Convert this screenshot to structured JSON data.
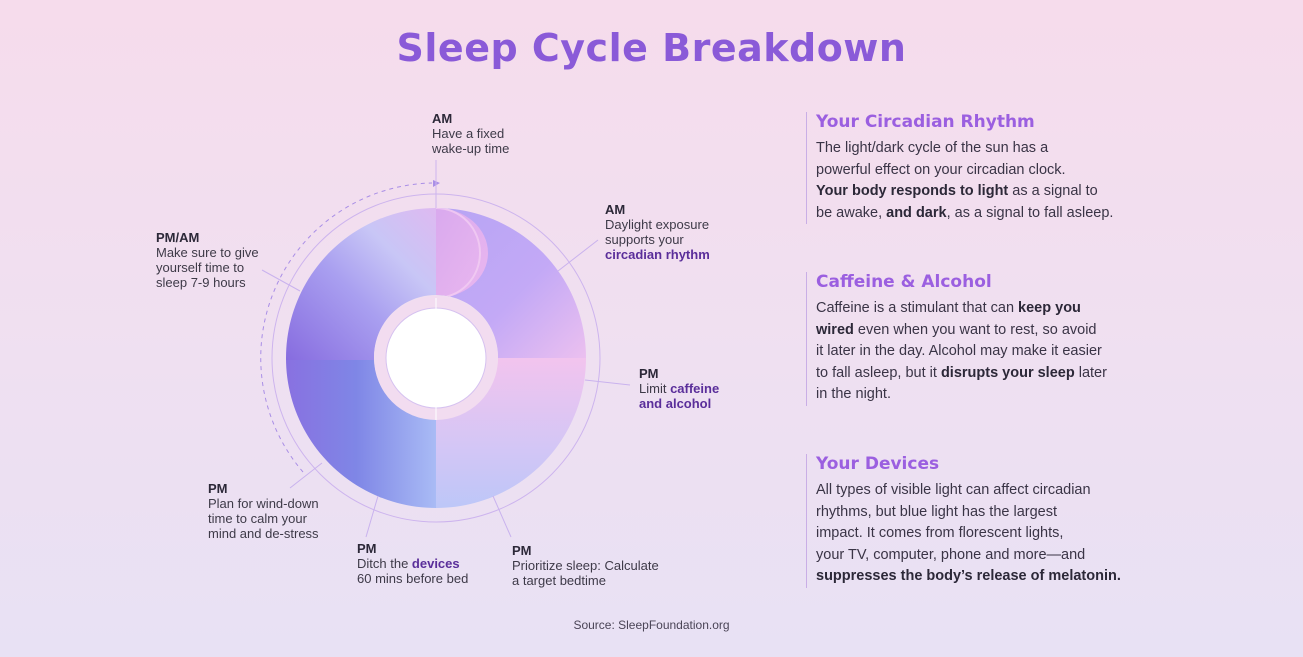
{
  "title": "Sleep Cycle Breakdown",
  "source": "Source: SleepFoundation.org",
  "colors": {
    "title": "#8a5ad8",
    "heading": "#9b5fe0",
    "highlight": "#5a2e9a",
    "ring_outline": "#cdb4ee"
  },
  "diagram": {
    "labels": {
      "am_wake": {
        "head": "AM",
        "l1": "Have a fixed",
        "l2": "wake-up time"
      },
      "am_daylight": {
        "head": "AM",
        "l1": "Daylight exposure",
        "l2": "supports your",
        "l3": "circadian rhythm"
      },
      "pm_caffeine": {
        "head": "PM",
        "l1a": "Limit ",
        "l1b": "caffeine",
        "l2": "and alcohol"
      },
      "pm_prioritize": {
        "head": "PM",
        "l1": "Prioritize sleep: Calculate",
        "l2": "a target bedtime"
      },
      "pm_devices": {
        "head": "PM",
        "l1a": "Ditch the ",
        "l1b": "devices",
        "l2": "60 mins before bed"
      },
      "pm_winddown": {
        "head": "PM",
        "l1": "Plan for wind-down",
        "l2": "time to calm your",
        "l3": "mind and de-stress"
      },
      "pmam_sleep": {
        "head": "PM/AM",
        "l1": "Make sure to give",
        "l2": "yourself time to",
        "l3": "sleep 7-9 hours"
      }
    }
  },
  "sections": {
    "circadian": {
      "heading": "Your Circadian Rhythm",
      "l1": "The light/dark cycle of the sun has a",
      "l2": "powerful effect on your circadian clock.",
      "l3b": "Your body responds to light",
      "l3": " as a signal to",
      "l4a": "be awake, ",
      "l4b": "and dark",
      "l4c": ", as a signal to fall asleep."
    },
    "caffeine": {
      "heading": "Caffeine & Alcohol",
      "l1a": "Caffeine is a stimulant that can ",
      "l1b": "keep you",
      "l2b": "wired",
      "l2": " even when you want to rest, so avoid",
      "l3": "it later in the day. Alcohol may make it easier",
      "l4a": "to fall asleep, but it ",
      "l4b": "disrupts your sleep",
      "l4c": " later",
      "l5": "in the night."
    },
    "devices": {
      "heading": "Your Devices",
      "l1": "All types of visible light can affect circadian",
      "l2": "rhythms, but blue light has the largest",
      "l3": "impact. It comes from florescent lights,",
      "l4": "your TV, computer, phone and more—and",
      "l5b": "suppresses the body’s release of melatonin."
    }
  }
}
